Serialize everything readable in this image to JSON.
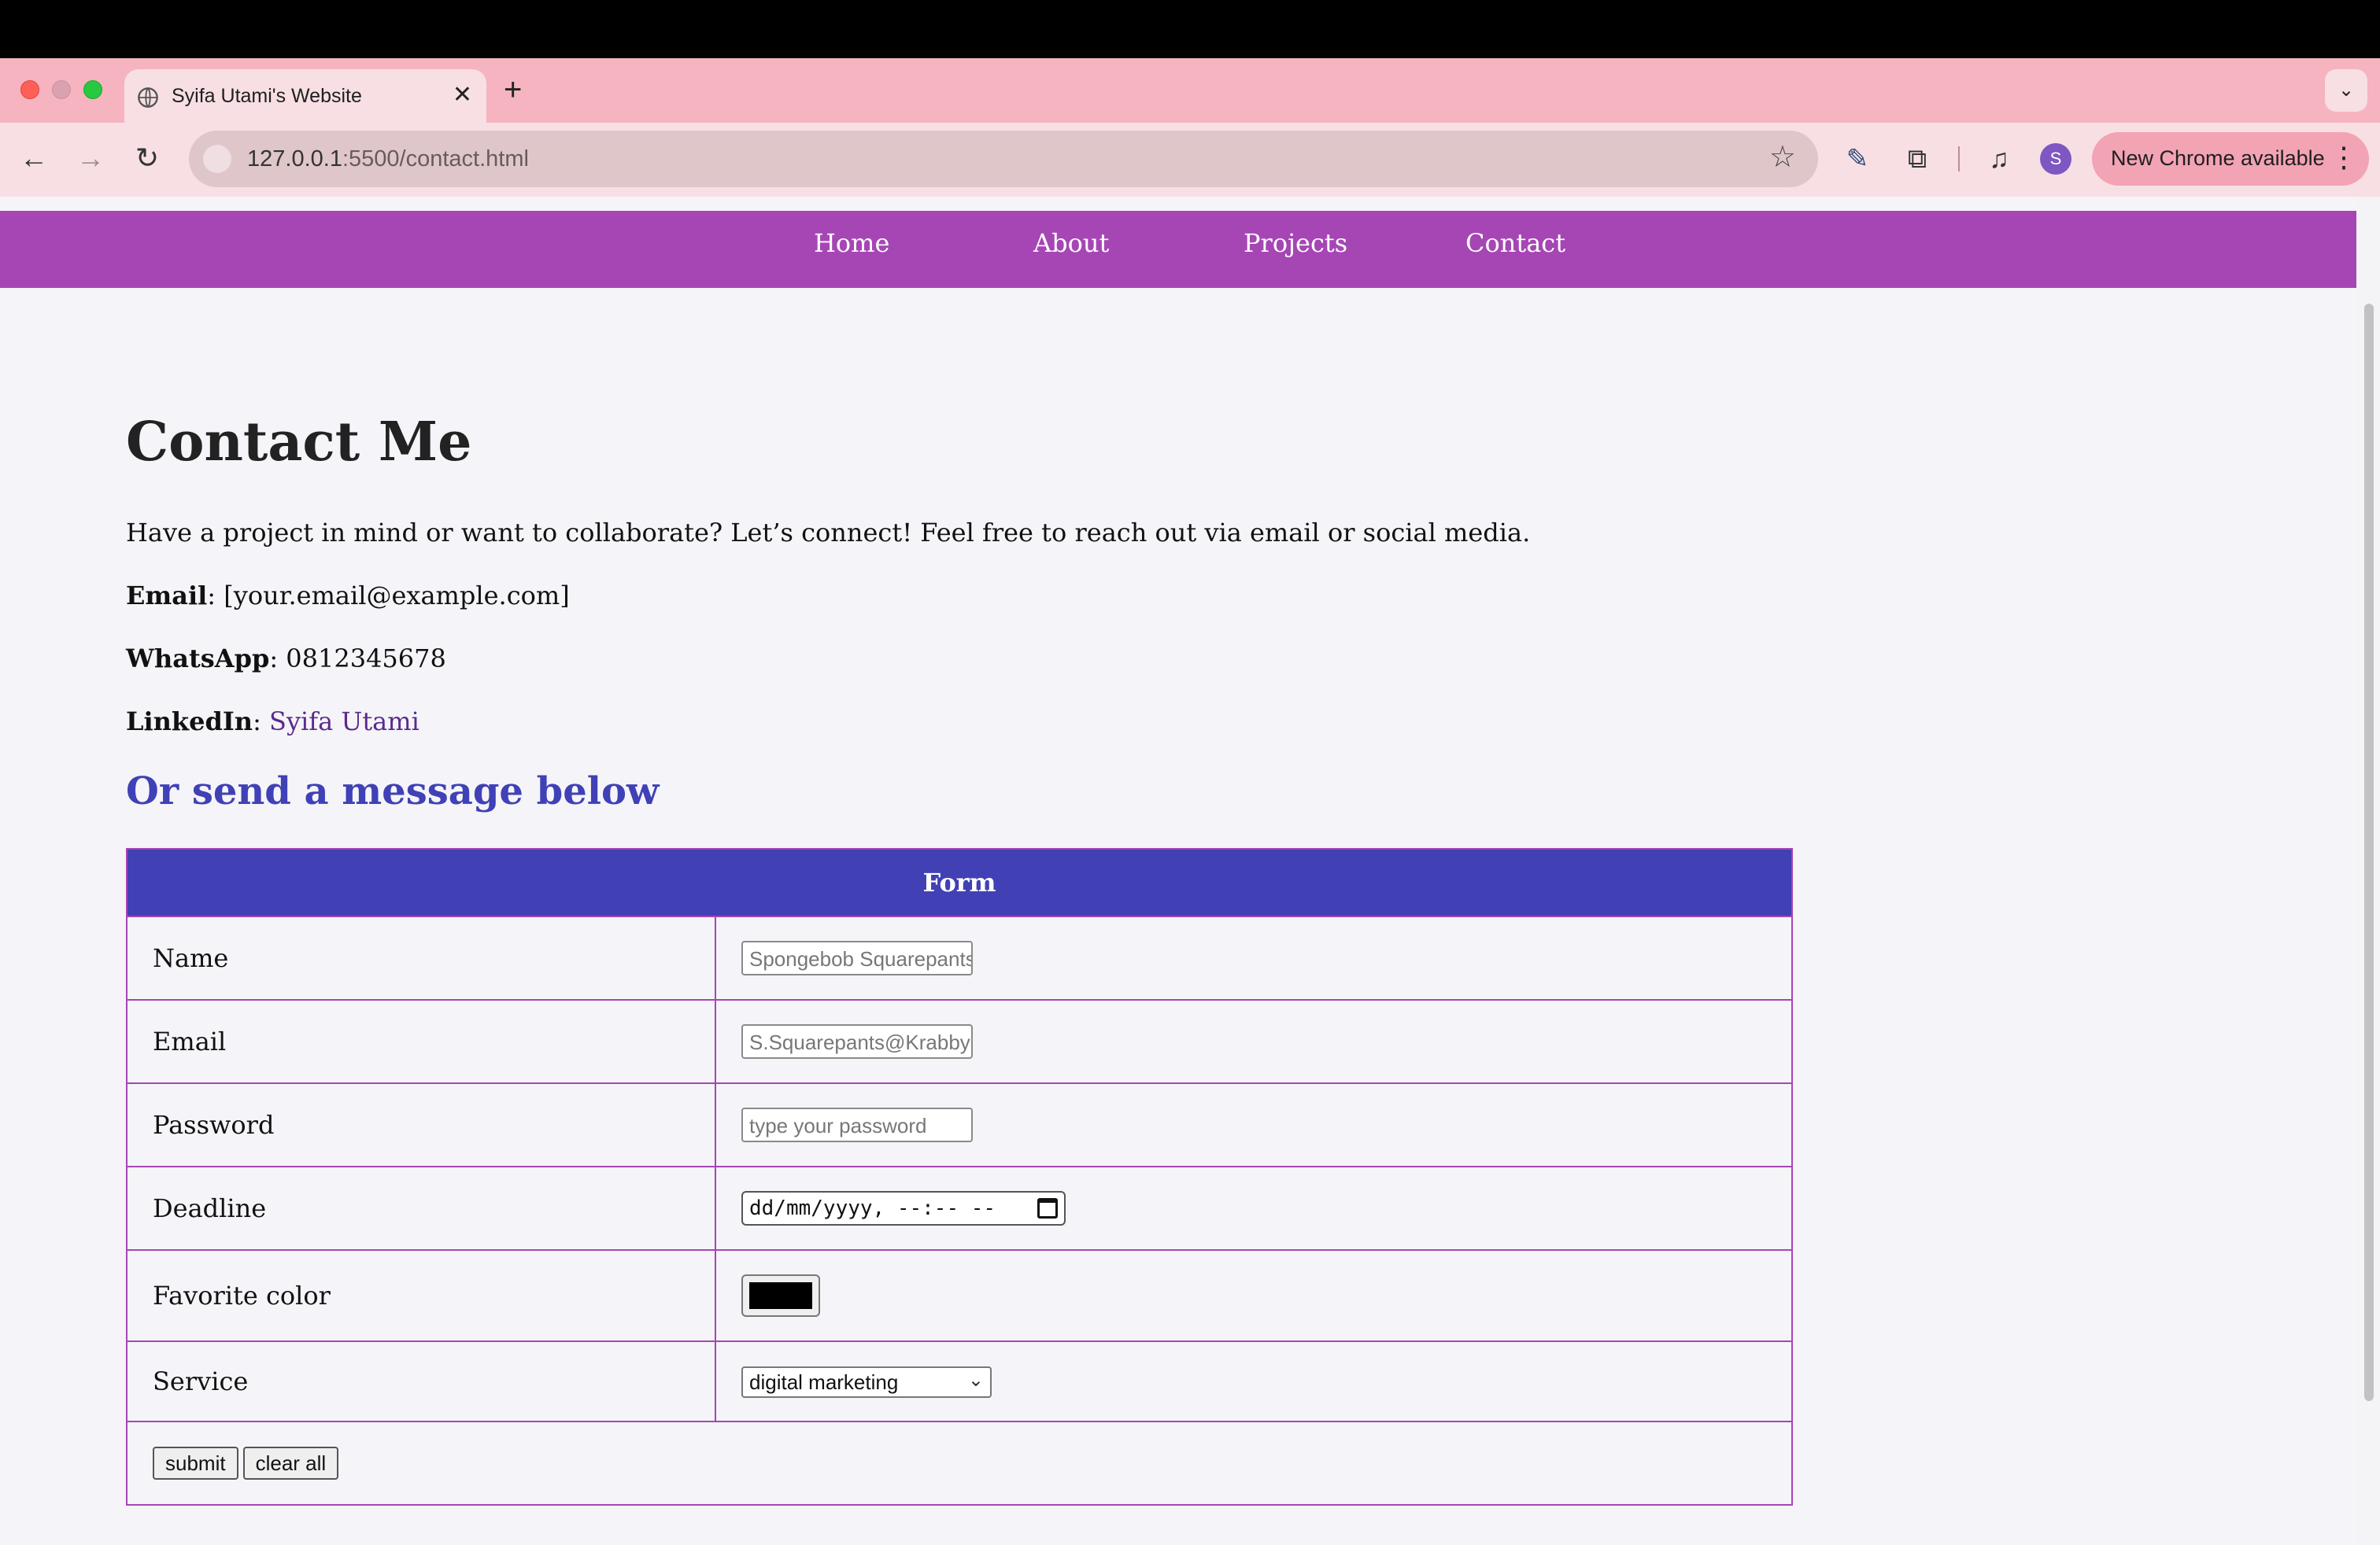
{
  "browser": {
    "tab_title": "Syifa Utami's Website",
    "url_host": "127.0.0.1",
    "url_rest": ":5500/contact.html",
    "update_label": "New Chrome available",
    "avatar_letter": "S"
  },
  "nav": {
    "home": "Home",
    "about": "About",
    "projects": "Projects",
    "contact": "Contact"
  },
  "page": {
    "title": "Contact Me",
    "intro": "Have a project in mind or want to collaborate? Let’s connect! Feel free to reach out via email or social media.",
    "email_label": "Email",
    "email_value": ": [your.email@example.com]",
    "whatsapp_label": "WhatsApp",
    "whatsapp_value": ": 0812345678",
    "linkedin_label": "LinkedIn",
    "linkedin_sep": ": ",
    "linkedin_link": "Syifa Utami",
    "subheading": "Or send a message below"
  },
  "form": {
    "header": "Form",
    "name_label": "Name",
    "name_placeholder": "Spongebob Squarepants",
    "email_label": "Email",
    "email_placeholder": "S.Squarepants@Krabby",
    "password_label": "Password",
    "password_placeholder": "type your password",
    "deadline_label": "Deadline",
    "deadline_value": "dd/mm/yyyy, --:-- --",
    "color_label": "Favorite color",
    "color_value": "#000000",
    "service_label": "Service",
    "service_selected": "digital marketing",
    "submit_label": "submit",
    "clear_label": "clear all"
  },
  "colors": {
    "navbar": "#a646b5",
    "table_header": "#4140b5",
    "subheading": "#4041b6",
    "chrome_frame": "#f6b3c0"
  }
}
